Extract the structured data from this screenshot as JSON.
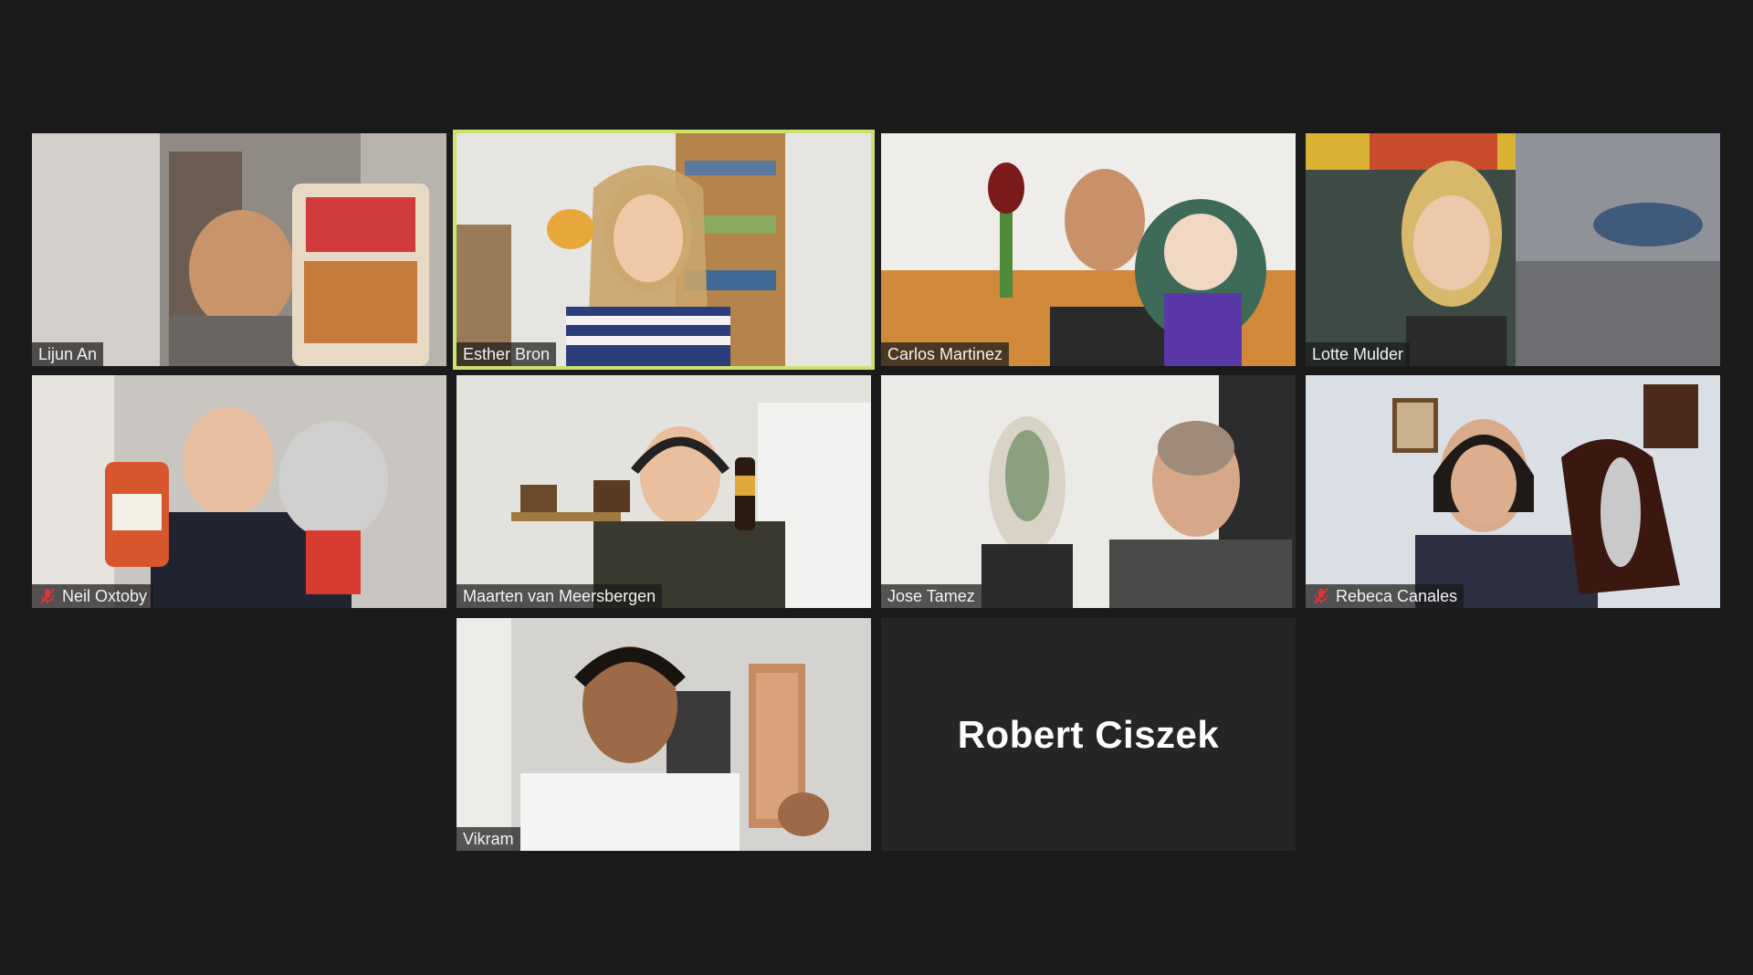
{
  "participants": [
    {
      "name": "Lijun An",
      "muted": false
    },
    {
      "name": "Esther Bron",
      "muted": false,
      "active_speaker": true
    },
    {
      "name": "Carlos Martinez",
      "muted": false
    },
    {
      "name": "Lotte Mulder",
      "muted": false
    },
    {
      "name": "Neil Oxtoby",
      "muted": true
    },
    {
      "name": "Maarten van Meersbergen",
      "muted": false
    },
    {
      "name": "Jose Tamez",
      "muted": false
    },
    {
      "name": "Rebeca Canales",
      "muted": true
    },
    {
      "name": "Vikram",
      "muted": false
    },
    {
      "name": "Robert Ciszek",
      "muted": false,
      "video_off": true
    }
  ],
  "colors": {
    "background": "#1a1a1a",
    "active_border": "#c9e36b",
    "mute_icon": "#e0333a",
    "name_text": "#f2f2f2"
  },
  "icons": {
    "mute": "microphone-muted-icon"
  }
}
